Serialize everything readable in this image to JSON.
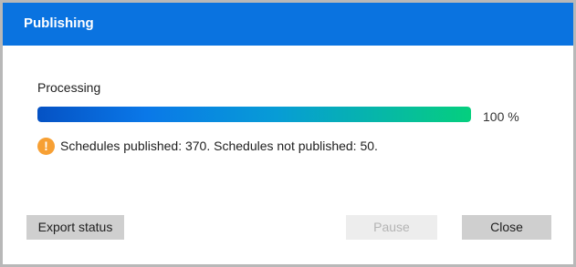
{
  "dialog": {
    "title": "Publishing",
    "processing_label": "Processing",
    "progress": {
      "percent": 100,
      "value_label": "100 %"
    },
    "status_message": "Schedules published: 370. Schedules not published: 50.",
    "status_icon": "warning-icon",
    "status_icon_glyph": "!",
    "buttons": {
      "export_label": "Export status",
      "pause_label": "Pause",
      "close_label": "Close"
    }
  },
  "colors": {
    "title_bar": "#0a73e0",
    "warning": "#f7a034",
    "progress_start": "#0552c4",
    "progress_end": "#05cf7e"
  }
}
